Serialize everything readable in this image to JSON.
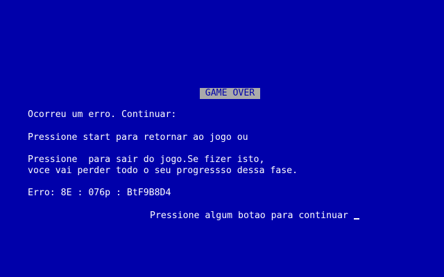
{
  "screen": {
    "title": "GAME OVER",
    "error_intro": "Ocorreu um erro. Continuar:",
    "option_start": "Pressione start para retornar ao jogo ou",
    "option_quit_line1": "Pressione  para sair do jogo.Se fizer isto,",
    "option_quit_line2": "voce vai perder todo o seu progressso dessa fase.",
    "error_code": "Erro: 8E : 076p : BtF9B8D4",
    "continue_prompt": "Pressione algum botao para continuar"
  },
  "colors": {
    "background": "#0000aa",
    "text": "#ffffff",
    "title_background": "#aaaaaa",
    "title_text": "#0000aa"
  }
}
